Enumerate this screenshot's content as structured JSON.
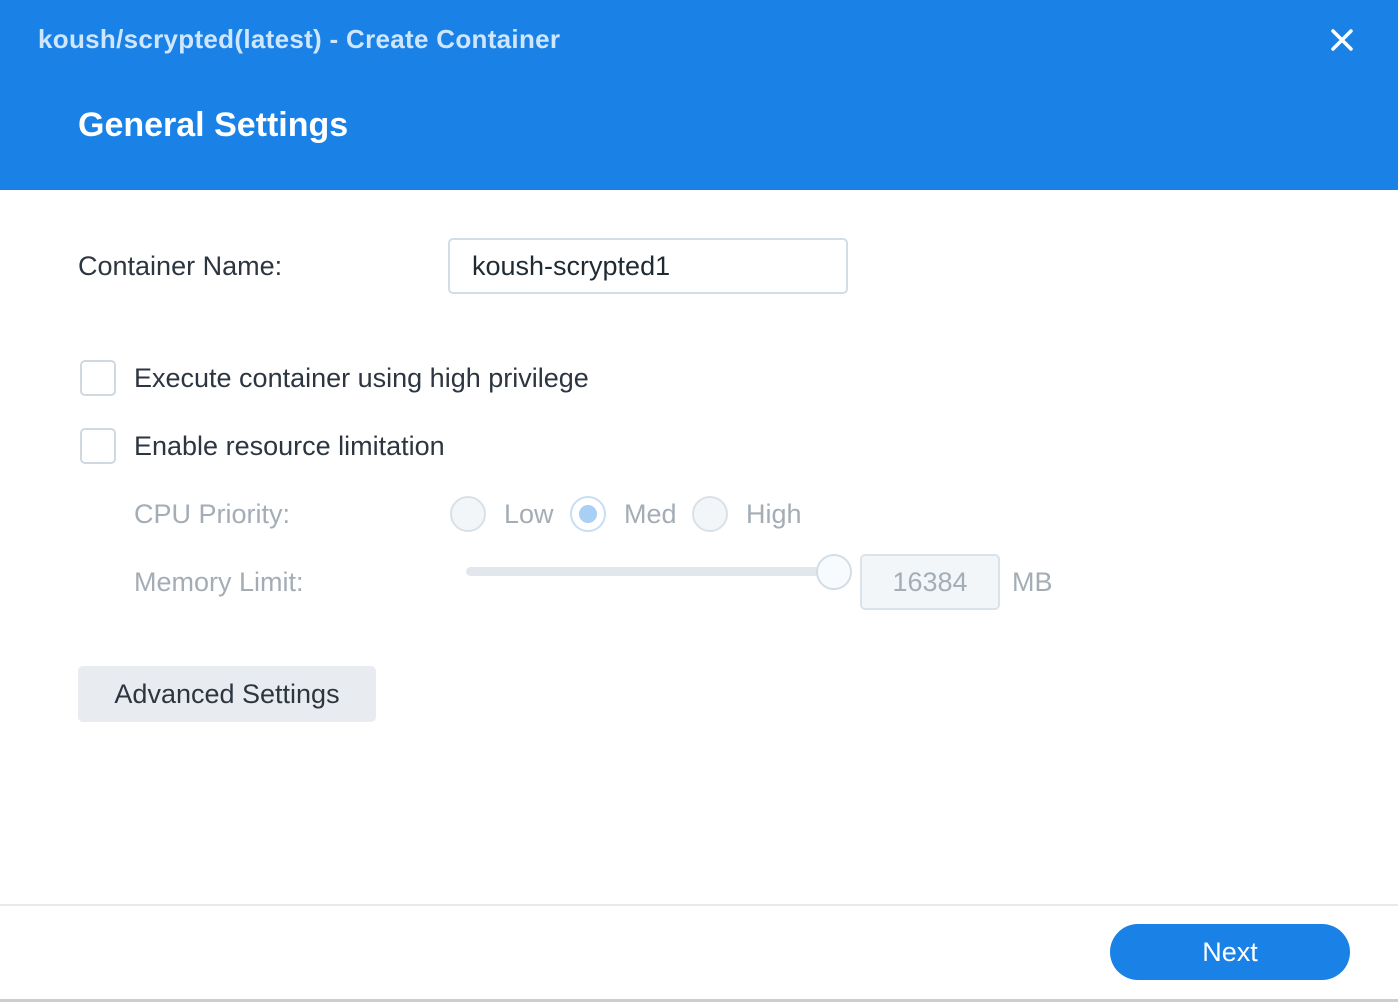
{
  "window": {
    "title": "koush/scrypted(latest) - Create Container",
    "close_icon": "close-icon"
  },
  "step": {
    "title": "General Settings"
  },
  "form": {
    "container_name_label": "Container Name:",
    "container_name_value": "koush-scrypted1",
    "high_privilege_label": "Execute container using high privilege",
    "high_privilege_checked": false,
    "resource_limit_label": "Enable resource limitation",
    "resource_limit_checked": false,
    "cpu_priority_label": "CPU Priority:",
    "cpu_priority_options": [
      "Low",
      "Med",
      "High"
    ],
    "cpu_priority_selected": "Med",
    "memory_limit_label": "Memory Limit:",
    "memory_limit_value": "16384",
    "memory_limit_unit": "MB",
    "memory_slider_fraction": 1.0
  },
  "buttons": {
    "advanced_settings": "Advanced Settings",
    "next": "Next"
  },
  "colors": {
    "header": "#1a82e6",
    "primary_button": "#1a82e6",
    "disabled_text": "#a4adb6"
  }
}
